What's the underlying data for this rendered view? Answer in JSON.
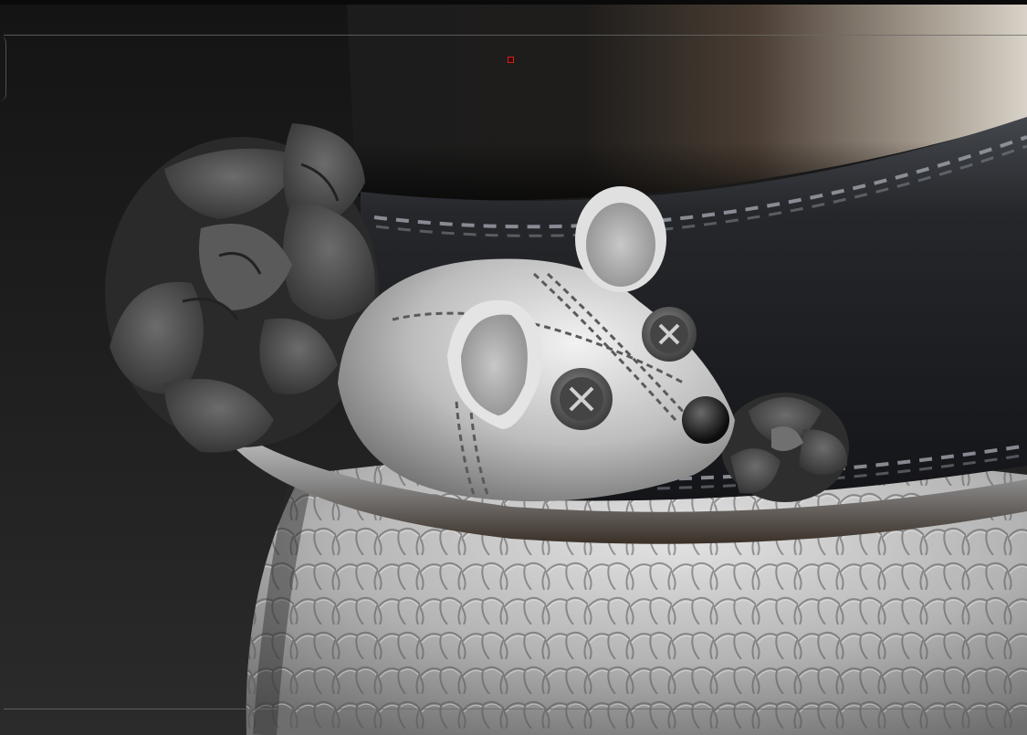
{
  "app": {
    "canvas": "3d-sculpt-viewport"
  },
  "scene": {
    "subject": "",
    "colors": {
      "background_dark": "#1a1a1a",
      "backdrop_warm": "#8a7a6a",
      "strap": "#2a2c30",
      "clay": "#b5b5b5",
      "marker": "#d02020"
    }
  },
  "icons": {
    "transform_marker": "transform-marker-icon"
  }
}
